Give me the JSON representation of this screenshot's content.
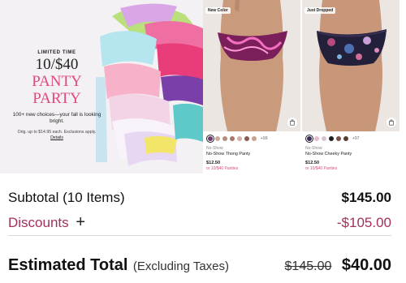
{
  "promo": {
    "eyebrow": "LIMITED TIME",
    "headline": "10/$40",
    "headline2": "PANTY",
    "headline3": "PARTY",
    "body": "100+ new choices—your fall is looking bright.",
    "fine_print": "Orig. up to $14.95 each. Exclusions apply.",
    "details_link": "Details",
    "accent_color": "#e0497f"
  },
  "products": [
    {
      "badge": "New Color",
      "kicker": "No-Show",
      "name": "No-Show Thong Panty",
      "price": "$12.50",
      "deal": "or 10/$40 Panties",
      "more_colors": "+99",
      "swatches": [
        "#6d3a6e",
        "#c9a99a",
        "#b58d80",
        "#a8786a",
        "#cdb3a4",
        "#8a5a4e",
        "#c8a18f"
      ]
    },
    {
      "badge": "Just Dropped",
      "kicker": "No-Show",
      "name": "No-Show Cheeky Panty",
      "price": "$12.50",
      "deal": "or 10/$40 Panties",
      "more_colors": "+97",
      "swatches": [
        "#3b2b5a",
        "#e9b9cf",
        "#d9c2d4",
        "#1e1e1e",
        "#7a5046",
        "#5a3b2e"
      ]
    }
  ],
  "summary": {
    "subtotal_label": "Subtotal (10 Items)",
    "subtotal_value": "$145.00",
    "discounts_label": "Discounts",
    "discounts_toggle": "+",
    "discounts_value": "-$105.00",
    "total_label": "Estimated Total",
    "total_note": "(Excluding Taxes)",
    "total_original": "$145.00",
    "total_value": "$40.00",
    "discount_color": "#a3305c"
  }
}
